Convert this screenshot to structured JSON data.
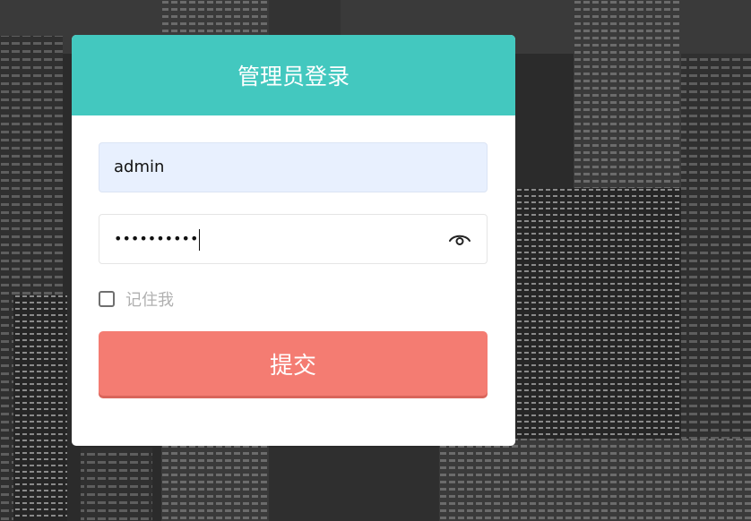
{
  "login": {
    "title": "管理员登录",
    "username_value": "admin",
    "password_mask": "••••••••••",
    "remember_label": "记住我",
    "submit_label": "提交"
  },
  "icons": {
    "password_toggle": "eye-icon"
  },
  "colors": {
    "header": "#43c8bf",
    "submit": "#f47c72",
    "background": "#2a2a2a"
  }
}
